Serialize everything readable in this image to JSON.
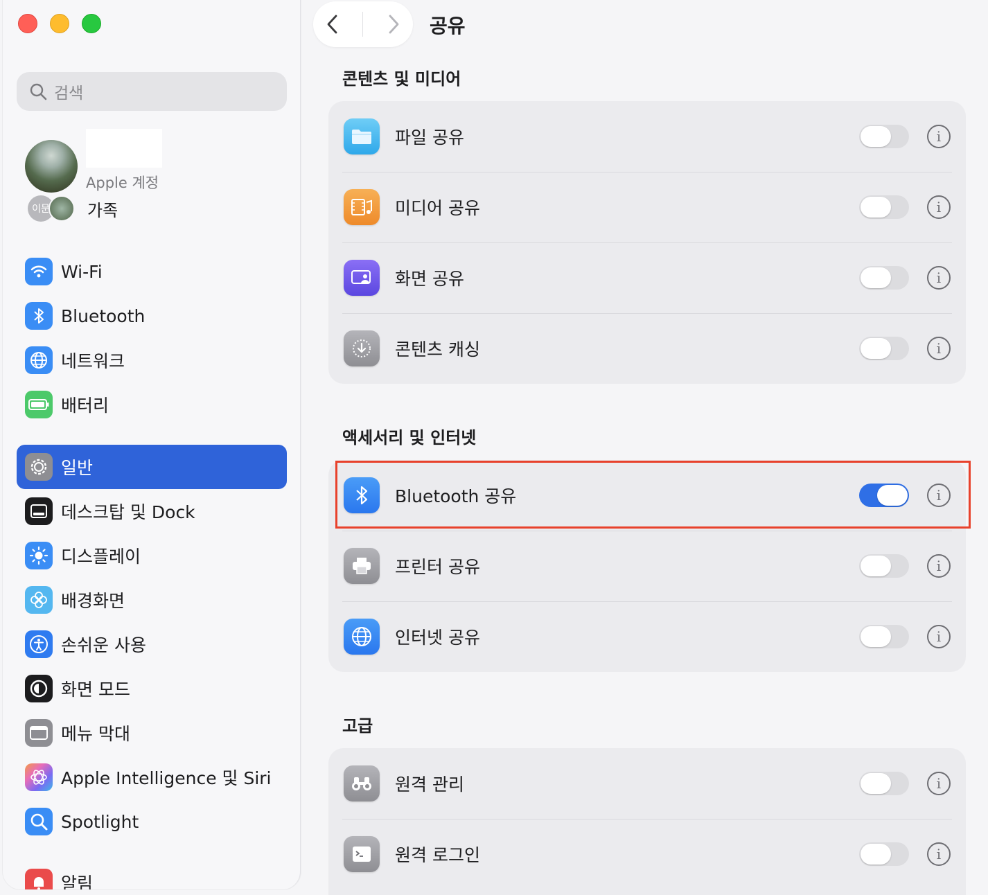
{
  "sidebar": {
    "search_placeholder": "검색",
    "account_sub": "Apple 계정",
    "family_avatar_text": "이문",
    "family_label": "가족",
    "items": [
      {
        "label": "Wi-Fi",
        "icon": "wifi-icon",
        "color": "#3a8df5"
      },
      {
        "label": "Bluetooth",
        "icon": "bluetooth-icon",
        "color": "#3a8df5"
      },
      {
        "label": "네트워크",
        "icon": "globe-icon",
        "color": "#3a8df5"
      },
      {
        "label": "배터리",
        "icon": "battery-icon",
        "color": "#4cc96a"
      },
      {
        "label": "일반",
        "icon": "gear-icon",
        "color": "#8e8e93",
        "active": true
      },
      {
        "label": "데스크탑 및 Dock",
        "icon": "dock-icon",
        "color": "#1c1c1e"
      },
      {
        "label": "디스플레이",
        "icon": "sun-icon",
        "color": "#3a8df5"
      },
      {
        "label": "배경화면",
        "icon": "flower-icon",
        "color": "#54b7f0"
      },
      {
        "label": "손쉬운 사용",
        "icon": "accessibility-icon",
        "color": "#2f7bf0"
      },
      {
        "label": "화면 모드",
        "icon": "screen-mode-icon",
        "color": "#1c1c1e"
      },
      {
        "label": "메뉴 막대",
        "icon": "menubar-icon",
        "color": "#8e8e93"
      },
      {
        "label": "Apple Intelligence 및 Siri",
        "icon": "siri-icon",
        "color": "#e76db8"
      },
      {
        "label": "Spotlight",
        "icon": "magnifier-icon",
        "color": "#3a8df5"
      },
      {
        "label": "알림",
        "icon": "bell-icon",
        "color": "#ea4b4b"
      }
    ]
  },
  "header": {
    "title": "공유"
  },
  "sections": [
    {
      "title": "콘텐츠 및 미디어",
      "rows": [
        {
          "label": "파일 공유",
          "on": false
        },
        {
          "label": "미디어 공유",
          "on": false
        },
        {
          "label": "화면 공유",
          "on": false
        },
        {
          "label": "콘텐츠 캐싱",
          "on": false
        }
      ]
    },
    {
      "title": "액세서리 및 인터넷",
      "rows": [
        {
          "label": "Bluetooth 공유",
          "on": true
        },
        {
          "label": "프린터 공유",
          "on": false
        },
        {
          "label": "인터넷 공유",
          "on": false
        }
      ]
    },
    {
      "title": "고급",
      "rows": [
        {
          "label": "원격 관리",
          "on": false
        },
        {
          "label": "원격 로그인",
          "on": false
        }
      ]
    }
  ],
  "info_glyph": "i",
  "colors": {
    "accent": "#2f63d9",
    "toggle_on": "#2f6fe6",
    "highlight": "#e8412b"
  }
}
